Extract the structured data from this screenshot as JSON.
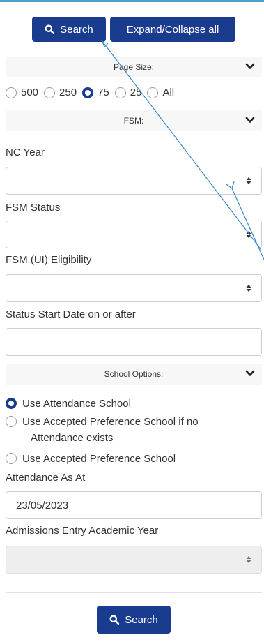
{
  "toolbar": {
    "search_label": "Search",
    "expand_collapse_label": "Expand/Collapse all"
  },
  "page_size": {
    "header": "Page Size:",
    "options": [
      "500",
      "250",
      "75",
      "25",
      "All"
    ],
    "selected": "75"
  },
  "fsm": {
    "header": "FSM:",
    "nc_year_label": "NC Year",
    "fsm_status_label": "FSM Status",
    "fsm_ui_eligibility_label": "FSM (UI) Eligibility",
    "status_start_date_label": "Status Start Date on or after",
    "status_start_date_value": ""
  },
  "school_options": {
    "header": "School Options:",
    "options": [
      {
        "line1": "Use Attendance School",
        "line2": ""
      },
      {
        "line1": "Use Accepted Preference School if no",
        "line2": "Attendance exists"
      },
      {
        "line1": "Use Accepted Preference School",
        "line2": ""
      }
    ],
    "selected_index": 0,
    "attendance_as_at_label": "Attendance As At",
    "attendance_as_at_value": "23/05/2023",
    "admissions_entry_label": "Admissions Entry Academic Year"
  },
  "footer": {
    "search_label": "Search"
  },
  "colors": {
    "primary": "#1a3c8f",
    "header_bg": "#f7f7f7",
    "top_line": "#4aa0c8",
    "annotation": "#3a86c8"
  },
  "icons": {
    "search": "search-icon",
    "chevron": "chevron-down-icon",
    "sort": "sort-icon"
  }
}
